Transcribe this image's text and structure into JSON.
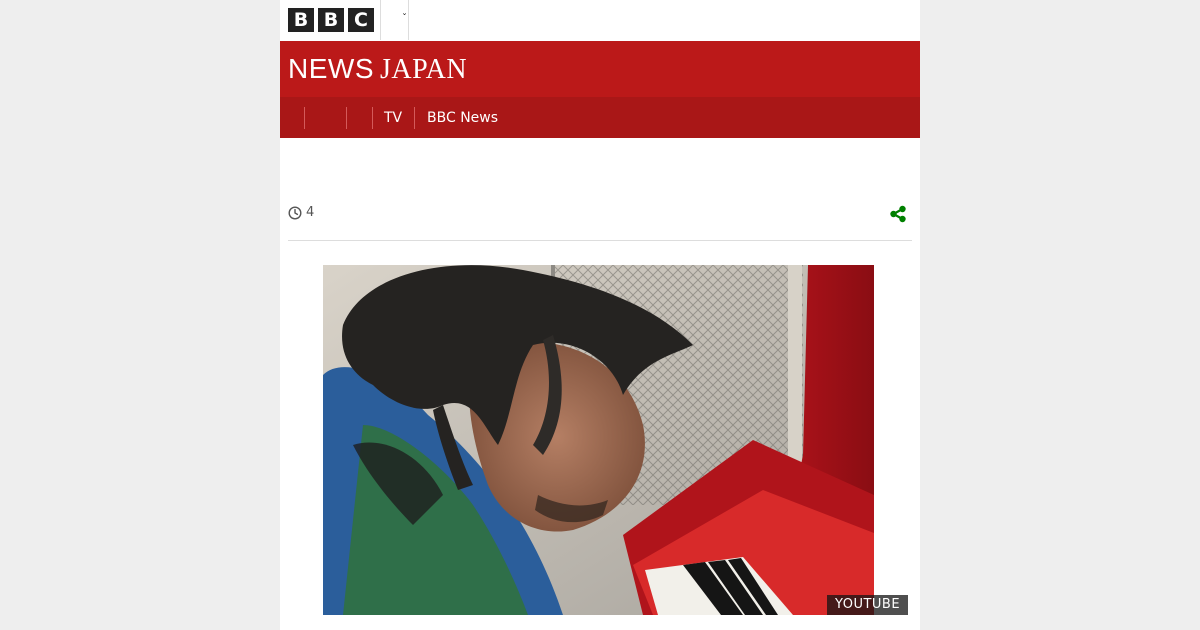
{
  "masthead": {
    "logo_letters": [
      "B",
      "B",
      "C"
    ],
    "more_icon": "chevron-down-icon"
  },
  "banner": {
    "brand_news": "NEWS",
    "brand_japan": "JAPAN"
  },
  "nav": {
    "items": [
      {
        "label": ""
      },
      {
        "label": ""
      },
      {
        "label": ""
      },
      {
        "label": "TV"
      },
      {
        "label": "BBC News"
      }
    ]
  },
  "article": {
    "read_time": "4",
    "clock_icon": "clock-icon",
    "share_icon": "share-icon"
  },
  "media": {
    "credit": "YOUTUBE",
    "icon": "photo-man-playing-red-piano"
  },
  "colors": {
    "brand_red": "#bb1919",
    "nav_red": "#a91717",
    "share_green": "#008000"
  }
}
